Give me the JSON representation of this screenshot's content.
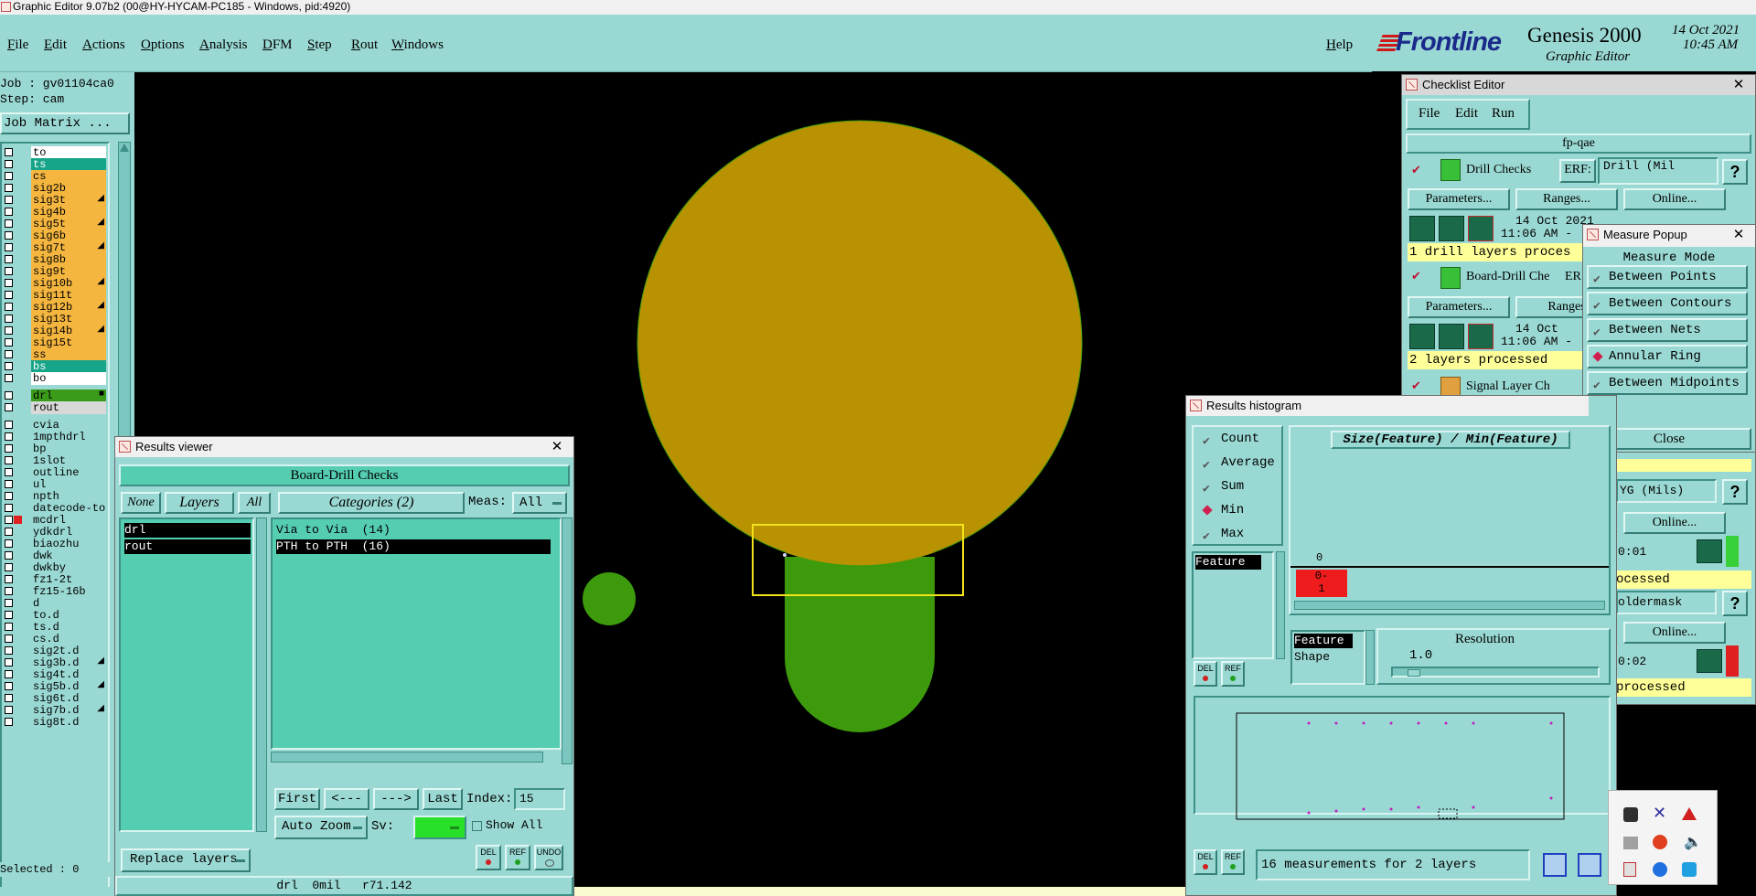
{
  "window_title": "Graphic Editor 9.07b2 (00@HY-HYCAM-PC185 - Windows, pid:4920)",
  "menu": [
    "File",
    "Edit",
    "Actions",
    "Options",
    "Analysis",
    "DFM",
    "Step",
    "Rout",
    "Windows"
  ],
  "help_label": "Help",
  "brand": {
    "logo": "Frontline",
    "product": "Genesis 2000",
    "subtitle": "Graphic Editor",
    "date": "14 Oct 2021",
    "time": "10:45 AM"
  },
  "job": {
    "job_line": "Job : gv01104ca0",
    "step_line": "Step: cam",
    "matrix_button": "Job Matrix ..."
  },
  "layers": [
    {
      "name": "to",
      "color": "#ffffff",
      "mark": ""
    },
    {
      "name": "ts",
      "color": "#17a58a",
      "mark": ""
    },
    {
      "name": "cs",
      "color": "#f5b640",
      "mark": ""
    },
    {
      "name": "sig2b",
      "color": "#f5b640",
      "mark": ""
    },
    {
      "name": "sig3t",
      "color": "#f5b640",
      "mark": "◢"
    },
    {
      "name": "sig4b",
      "color": "#f5b640",
      "mark": ""
    },
    {
      "name": "sig5t",
      "color": "#f5b640",
      "mark": "◢"
    },
    {
      "name": "sig6b",
      "color": "#f5b640",
      "mark": ""
    },
    {
      "name": "sig7t",
      "color": "#f5b640",
      "mark": "◢"
    },
    {
      "name": "sig8b",
      "color": "#f5b640",
      "mark": ""
    },
    {
      "name": "sig9t",
      "color": "#f5b640",
      "mark": ""
    },
    {
      "name": "sig10b",
      "color": "#f5b640",
      "mark": "◢"
    },
    {
      "name": "sig11t",
      "color": "#f5b640",
      "mark": ""
    },
    {
      "name": "sig12b",
      "color": "#f5b640",
      "mark": "◢"
    },
    {
      "name": "sig13t",
      "color": "#f5b640",
      "mark": ""
    },
    {
      "name": "sig14b",
      "color": "#f5b640",
      "mark": "◢"
    },
    {
      "name": "sig15t",
      "color": "#f5b640",
      "mark": ""
    },
    {
      "name": "ss",
      "color": "#f5b640",
      "mark": ""
    },
    {
      "name": "bs",
      "color": "#17a58a",
      "mark": ""
    },
    {
      "name": "bo",
      "color": "#ffffff",
      "mark": ""
    }
  ],
  "drill_layers": [
    {
      "name": "drl",
      "color": "#3a9a1a",
      "mark": "■"
    },
    {
      "name": "rout",
      "color": "#d8d8d8",
      "mark": ""
    }
  ],
  "other_layers": [
    "cvia",
    "1mpthdrl",
    "bp",
    "1slot",
    "outline",
    "ul",
    "npth",
    "datecode-to",
    "mcdrl",
    "ydkdrl",
    "biaozhu",
    "dwk",
    "dwkby",
    "fz1-2t",
    "fz15-16b",
    "d",
    "to.d",
    "ts.d",
    "cs.d",
    "sig2t.d",
    "sig3b.d",
    "sig4t.d",
    "sig5b.d",
    "sig6t.d",
    "sig7b.d",
    "sig8t.d"
  ],
  "selected_label": "Selected : 0",
  "results_viewer": {
    "title": "Results viewer",
    "header": "Board-Drill Checks",
    "none": "None",
    "layers": "Layers",
    "all": "All",
    "categories": "Categories (2)",
    "meas_label": "Meas:",
    "meas_value": "All",
    "layer_items": [
      "drl",
      "rout"
    ],
    "category_items": [
      "Via to Via  (14)",
      "PTH to PTH  (16)"
    ],
    "first": "First",
    "prev": "<---",
    "next": "--->",
    "last": "Last",
    "index_label": "Index:",
    "index_value": "15",
    "auto_zoom": "Auto Zoom",
    "sv_label": "Sv:",
    "show_all": "Show All",
    "replace_layers": "Replace layers",
    "del": "DEL",
    "ref": "REF",
    "undo": "UNDO",
    "status": "drl  0mil   r71.142"
  },
  "checklist": {
    "title": "Checklist Editor",
    "menu": [
      "File",
      "Edit",
      "Run"
    ],
    "name": "fp-qae",
    "drill_checks": "Drill Checks",
    "erf": "ERF:",
    "erf_value": "Drill (Mil",
    "parameters": "Parameters...",
    "ranges": "Ranges...",
    "online": "Online...",
    "date1": "14 Oct 2021",
    "time1": "11:06 AM -",
    "processed1": "1 drill layers proces",
    "board_drill": "Board-Drill Che",
    "ranges2": "Ranges",
    "date2": "14 Oct",
    "time2": "11:06 AM -",
    "processed2": "2 layers processed",
    "signal_layer": "Signal Layer Ch",
    "erf_short": "ER",
    "lower_erf": "YG (Mils)",
    "lower_time1": "0:01",
    "lower_processed1": "ocessed",
    "lower_soldermask": "oldermask",
    "lower_time2": "0:02",
    "lower_processed2": "processed"
  },
  "measure": {
    "title": "Measure Popup",
    "mode_label": "Measure Mode",
    "items": [
      "Between Points",
      "Between Contours",
      "Between Nets",
      "Annular Ring",
      "Between Midpoints"
    ],
    "selected": "Annular Ring",
    "close": "Close"
  },
  "histogram": {
    "title": "Results histogram",
    "options": [
      "Count",
      "Average",
      "Sum",
      "Min",
      "Max"
    ],
    "selected": "Min",
    "formula": "Size(Feature) / Min(Feature)",
    "axis_zero": "0",
    "bin_top": "0-",
    "bin_bottom": "1",
    "feature": "Feature",
    "shape": "Shape",
    "resolution_label": "Resolution",
    "resolution_value": "1.0",
    "status": "16 measurements for 2 layers",
    "del": "DEL",
    "ref": "REF"
  },
  "colors": {
    "teal": "#9ad9d3",
    "teal_dark": "#55cdb1",
    "pad_yellow": "#b89200",
    "pad_green": "#3d9a0c",
    "selection": "#ffee00"
  }
}
